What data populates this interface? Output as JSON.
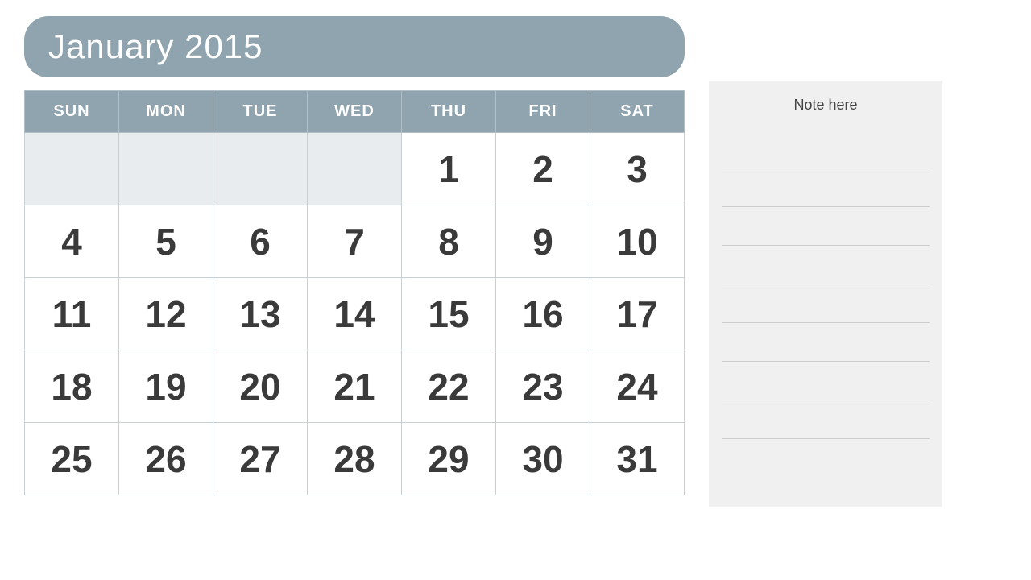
{
  "header": {
    "month_year": "January 2015"
  },
  "calendar": {
    "days_of_week": [
      "SUN",
      "MON",
      "TUE",
      "WED",
      "THU",
      "FRI",
      "SAT"
    ],
    "weeks": [
      [
        "",
        "",
        "",
        "",
        "1",
        "2",
        "3"
      ],
      [
        "4",
        "5",
        "6",
        "7",
        "8",
        "9",
        "10"
      ],
      [
        "11",
        "12",
        "13",
        "14",
        "15",
        "16",
        "17"
      ],
      [
        "18",
        "19",
        "20",
        "21",
        "22",
        "23",
        "24"
      ],
      [
        "25",
        "26",
        "27",
        "28",
        "29",
        "30",
        "31"
      ]
    ]
  },
  "note": {
    "title": "Note here",
    "lines": 8
  }
}
